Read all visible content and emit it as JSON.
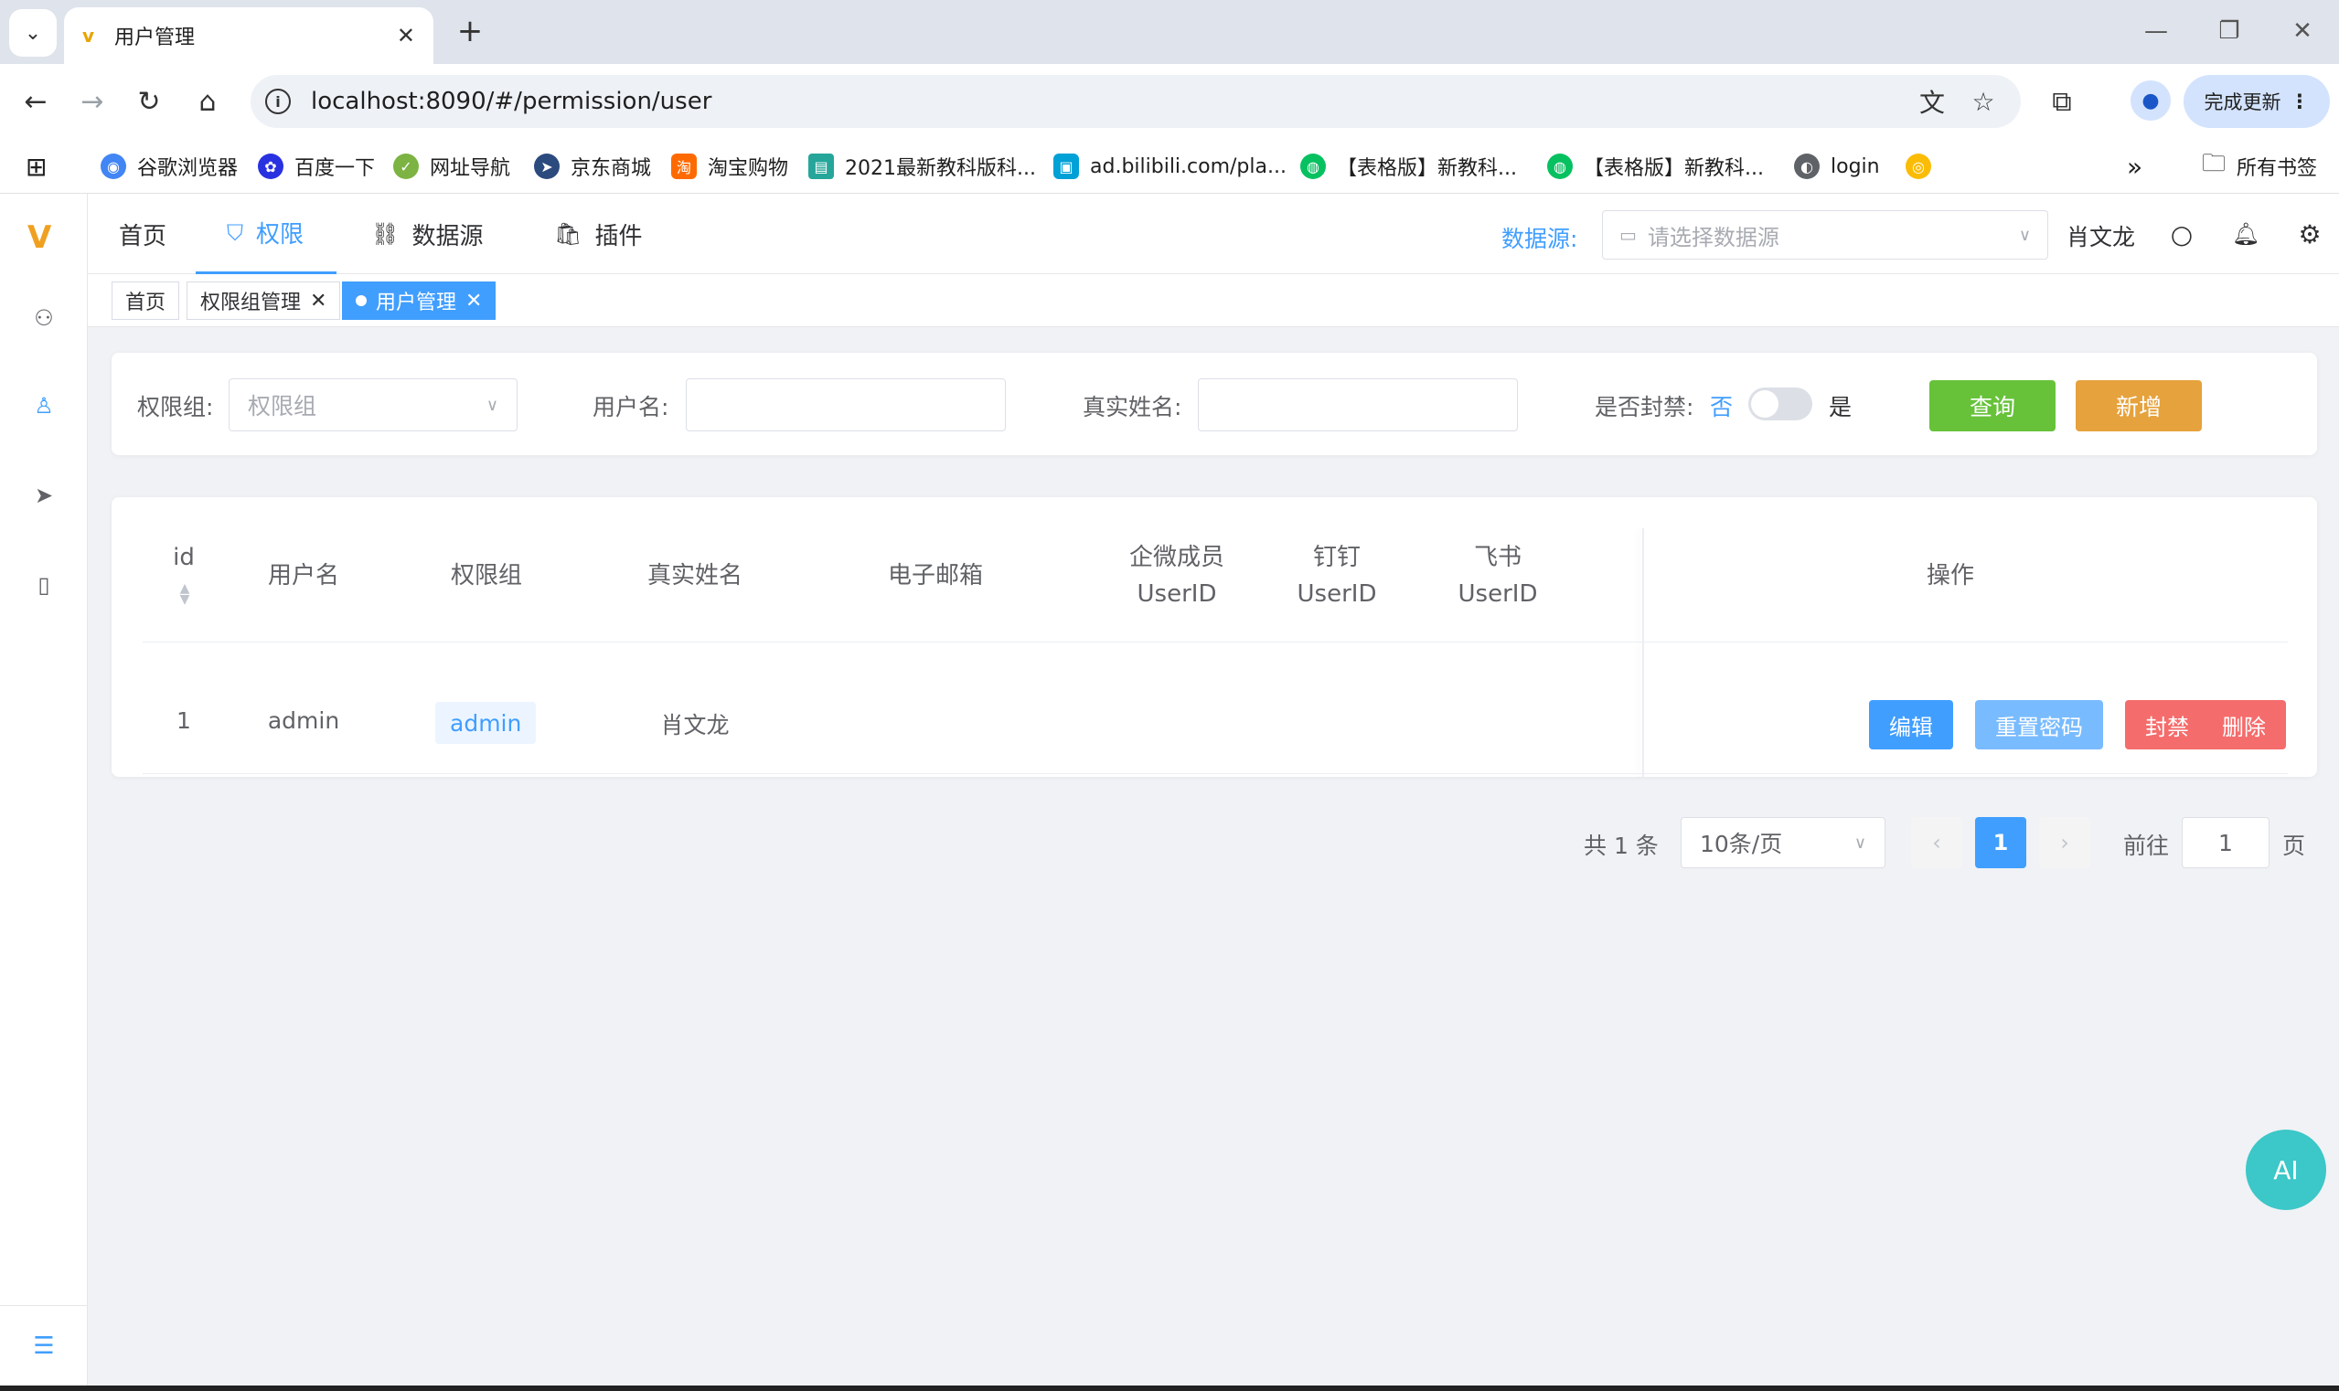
{
  "browser": {
    "tab_title": "用户管理",
    "url": "localhost:8090/#/permission/user",
    "update_label": "完成更新",
    "bookmarks": [
      {
        "label": "谷歌浏览器",
        "color": "#4285f4"
      },
      {
        "label": "百度一下",
        "color": "#2932e1"
      },
      {
        "label": "网址导航",
        "color": "#7cb342"
      },
      {
        "label": "京东商城",
        "color": "#2b4a7e"
      },
      {
        "label": "淘宝购物",
        "color": "#ff6a00"
      },
      {
        "label": "2021最新教科版科...",
        "color": "#26a69a"
      },
      {
        "label": "ad.bilibili.com/pla...",
        "color": "#00a1d6"
      },
      {
        "label": "【表格版】新教科...",
        "color": "#07c160"
      },
      {
        "label": "【表格版】新教科...",
        "color": "#07c160"
      },
      {
        "label": "login",
        "color": "#5f6368"
      }
    ],
    "all_bookmarks": "所有书签"
  },
  "topnav": {
    "items": [
      {
        "label": "首页"
      },
      {
        "label": "权限"
      },
      {
        "label": "数据源"
      },
      {
        "label": "插件"
      }
    ],
    "datasource_label": "数据源:",
    "datasource_placeholder": "请选择数据源",
    "user_name": "肖文龙"
  },
  "tags": [
    {
      "label": "首页"
    },
    {
      "label": "权限组管理"
    },
    {
      "label": "用户管理"
    }
  ],
  "filter": {
    "group_label": "权限组:",
    "group_placeholder": "权限组",
    "username_label": "用户名:",
    "username_value": "",
    "realname_label": "真实姓名:",
    "realname_value": "",
    "banned_label": "是否封禁:",
    "banned_off": "否",
    "banned_on": "是",
    "banned_value": false,
    "query_label": "查询",
    "add_label": "新增"
  },
  "table": {
    "headers": {
      "id": "id",
      "username": "用户名",
      "group": "权限组",
      "realname": "真实姓名",
      "email": "电子邮箱",
      "wecom_1": "企微成员",
      "wecom_2": "UserID",
      "dingtalk_1": "钉钉",
      "dingtalk_2": "UserID",
      "feishu_1": "飞书",
      "feishu_2": "UserID",
      "actions": "操作"
    },
    "rows": [
      {
        "id": "1",
        "username": "admin",
        "group": "admin",
        "realname": "肖文龙",
        "email": "",
        "wecom": "",
        "dingtalk": "",
        "feishu": ""
      }
    ],
    "actions": {
      "edit": "编辑",
      "reset": "重置密码",
      "ban": "封禁",
      "delete": "删除"
    }
  },
  "pagination": {
    "total_text": "共 1 条",
    "page_size": "10条/页",
    "current_page": "1",
    "goto_label": "前往",
    "goto_value": "1",
    "page_suffix": "页"
  },
  "ai_label": "AI",
  "colors": {
    "primary": "#409eff",
    "success": "#67c23a",
    "warning": "#e6a23c",
    "danger": "#f56c6c",
    "reset_btn": "#79bbff"
  }
}
